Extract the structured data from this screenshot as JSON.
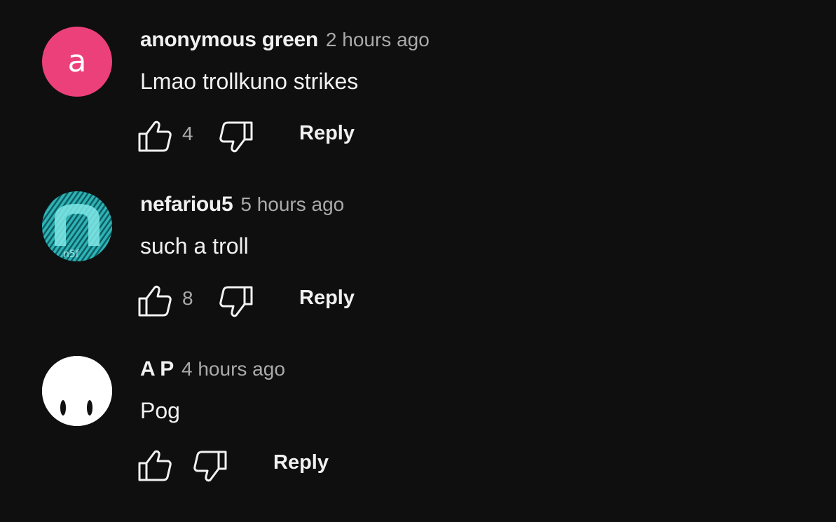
{
  "comments": [
    {
      "author": "anonymous green",
      "time": "2 hours ago",
      "text": "Lmao trollkuno strikes",
      "avatar_letter": "a",
      "avatar_color": "#ec407a",
      "likes": "4",
      "reply_label": "Reply"
    },
    {
      "author": "nefariou5",
      "time": "5 hours ago",
      "text": "such a troll",
      "avatar_letter": "n",
      "avatar_color": "#2aa3a6",
      "likes": "8",
      "reply_label": "Reply"
    },
    {
      "author": "A P",
      "time": "4 hours ago",
      "text": "Pog",
      "avatar_color": "#ffffff",
      "likes": "",
      "reply_label": "Reply"
    }
  ],
  "icons": {
    "like": "thumb-up-icon",
    "dislike": "thumb-down-icon"
  },
  "colors": {
    "background": "#0f0f0f",
    "primary_text": "#f1f1f1",
    "secondary_text": "#aaaaaa"
  }
}
